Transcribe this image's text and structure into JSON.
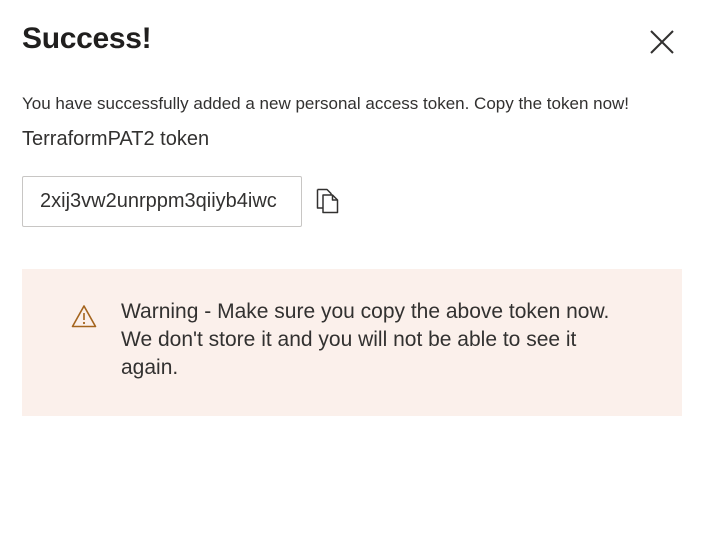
{
  "dialog": {
    "title": "Success!",
    "message": "You have successfully added a new personal access token. Copy the token now!",
    "token_name": "TerraformPAT2 token",
    "token_value": "2xij3vw2unrppm3qiiyb4iwc",
    "warning_text": "Warning - Make sure you copy the above token now. We don't store it and you will not be able to see it again."
  },
  "icons": {
    "close": "close-icon",
    "copy": "copy-icon",
    "warning": "warning-icon"
  },
  "colors": {
    "warning_background": "#fbf0eb",
    "warning_icon": "#a4641d",
    "text": "#323130"
  }
}
